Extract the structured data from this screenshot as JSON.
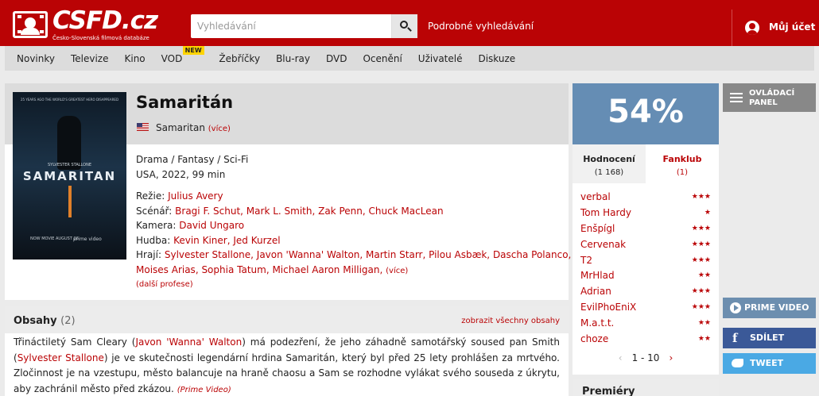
{
  "header": {
    "logo_text": "CSFD.cz",
    "logo_subtitle": "Česko-Slovenská filmová databáze",
    "search_placeholder": "Vyhledávání",
    "advanced_search": "Podrobné vyhledávání",
    "account_label": "Můj účet",
    "brand_color": "#ba0305"
  },
  "nav": {
    "items": [
      {
        "label": "Novinky"
      },
      {
        "label": "Televize"
      },
      {
        "label": "Kino"
      },
      {
        "label": "VOD",
        "badge": "NEW"
      },
      {
        "label": "Žebříčky"
      },
      {
        "label": "Blu-ray"
      },
      {
        "label": "DVD"
      },
      {
        "label": "Ocenění"
      },
      {
        "label": "Uživatelé"
      },
      {
        "label": "Diskuze"
      }
    ]
  },
  "film": {
    "title": "Samaritán",
    "original_title": "Samaritan",
    "original_more": "(více)",
    "genres": "Drama / Fantasy / Sci-Fi",
    "origin": "USA, 2022, 99 min",
    "poster": {
      "tagline": "25 YEARS AGO THE WORLD'S GREATEST HERO DISAPPEARED",
      "actor": "SYLVESTER STALLONE",
      "title": "SAMARITAN",
      "footer": "NOW MOVIE AUGUST 26",
      "platform": "prime video"
    },
    "crew": {
      "director_label": "Režie:",
      "director": "Julius Avery",
      "writers_label": "Scénář:",
      "writers": "Bragi F. Schut, Mark L. Smith, Zak Penn, Chuck MacLean",
      "camera_label": "Kamera:",
      "camera": "David Ungaro",
      "music_label": "Hudba:",
      "music": "Kevin Kiner, Jed Kurzel",
      "cast_label": "Hrají:",
      "cast_line1": "Sylvester Stallone, Javon 'Wanna' Walton, Martin Starr, Pilou Asbæk, Dascha Polanco,",
      "cast_line2": "Moises Arias, Sophia Tatum, Michael Aaron Milligan,",
      "cast_more": "(více)",
      "other_professions": "(další profese)"
    }
  },
  "plot": {
    "title": "Obsahy",
    "count": "(2)",
    "show_all": "zobrazit všechny obsahy",
    "text_1": "Třináctiletý Sam Cleary (",
    "link_1": "Javon 'Wanna' Walton",
    "text_2": ") má podezření, že jeho záhadně samotářský soused pan Smith (",
    "link_2": "Sylvester Stallone",
    "text_3": ") je ve skutečnosti legendární hrdina Samaritán, který byl před 25 lety prohlášen za mrtvého. Zločinnost je na vzestupu, město balancuje na hraně chaosu a Sam se rozhodne vylákat svého souseda z úkrytu, aby zachránil město před zkázou.",
    "source": "(Prime Video)"
  },
  "rating": {
    "value": "54%",
    "box_color": "#658db4",
    "tab_ratings_label": "Hodnocení",
    "tab_ratings_count": "(1 168)",
    "tab_fanclub_label": "Fanklub",
    "tab_fanclub_count": "(1)",
    "raters": [
      {
        "name": "verbal",
        "stars": "★★★"
      },
      {
        "name": "Tom Hardy",
        "stars": "★"
      },
      {
        "name": "Enšpígl",
        "stars": "★★★"
      },
      {
        "name": "Cervenak",
        "stars": "★★★"
      },
      {
        "name": "T2",
        "stars": "★★★"
      },
      {
        "name": "MrHlad",
        "stars": "★★"
      },
      {
        "name": "Adrian",
        "stars": "★★★"
      },
      {
        "name": "EvilPhoEniX",
        "stars": "★★★"
      },
      {
        "name": "M.a.t.t.",
        "stars": "★★"
      },
      {
        "name": "choze",
        "stars": "★★"
      }
    ],
    "pager_label": "1 - 10",
    "prev_icon": "chevron-left-icon",
    "next_icon": "chevron-right-icon"
  },
  "premiery": {
    "title": "Premiéry"
  },
  "sidebar": {
    "control_panel": "OVLÁDACÍ PANEL",
    "prime_video": "PRIME VIDEO",
    "share": "SDÍLET",
    "tweet": "TWEET"
  }
}
